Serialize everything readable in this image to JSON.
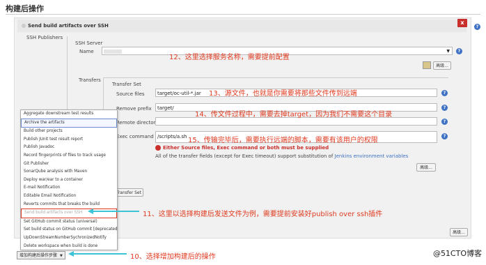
{
  "section_title": "构建后操作",
  "panel": {
    "title": "Send build artifacts over SSH",
    "close": "x",
    "publishers_label": "SSH Publishers",
    "server_label": "SSH Server",
    "name_label": "Name",
    "advanced": "高级...",
    "transfers_label": "Transfers",
    "transfer_set": "Transfer Set",
    "source_label": "Source files",
    "source_value": "target/oc-util-*.jar",
    "remove_label": "Remove prefix",
    "remove_value": "target/",
    "remote_label": "Remote directory",
    "remote_value": "",
    "exec_label": "Exec command",
    "exec_value": "/scripts/a.sh",
    "error": "Either Source files, Exec command or both must be supplied",
    "note_prefix": "All of the transfer fields (except for Exec timeout) support substitution of",
    "note_link": "Jenkins environment variables",
    "add_transfer": "Transfer Set",
    "help": "?"
  },
  "annotations": {
    "a12": "12、这里选择服务名称，需要提前配置",
    "a13": "13、源文件，也就是你需要将那些文件传到远端",
    "a14": "14、传文件过程中，需要去掉target，因为我们不需要这个目录",
    "a15": "15、传输完毕后，需要执行远端的脚本，需要有该用户的权限",
    "a11": "11、这里以选择构建后发送文件为例，需要提前安装好publish over ssh插件",
    "a10": "10、选择增加构建后的操作"
  },
  "menu_items": [
    "Aggregate downstream test results",
    "Archive the artifacts",
    "Build other projects",
    "Publish JUnit test result report",
    "Publish Javadoc",
    "Record fingerprints of files to track usage",
    "Git Publisher",
    "SonarQube analysis with Maven",
    "Deploy war/ear to a container",
    "E-mail Notification",
    "Editable Email Notification",
    "Reverts commits that breaks the build",
    "Send build artifacts over SSH",
    "Set GitHub commit status (universal)",
    "Set build status on GitHub commit [deprecated]",
    "UpDownStreamNumberSychronizedNotify",
    "Delete workspace when build is done"
  ],
  "add_button": "增加构建后操作步骤",
  "watermark": "@51CTO博客",
  "colors": {
    "accent": "#3f71c4",
    "error": "#c9302c",
    "annotation": "#e03a1f",
    "arrow": "#3cc3d6"
  }
}
